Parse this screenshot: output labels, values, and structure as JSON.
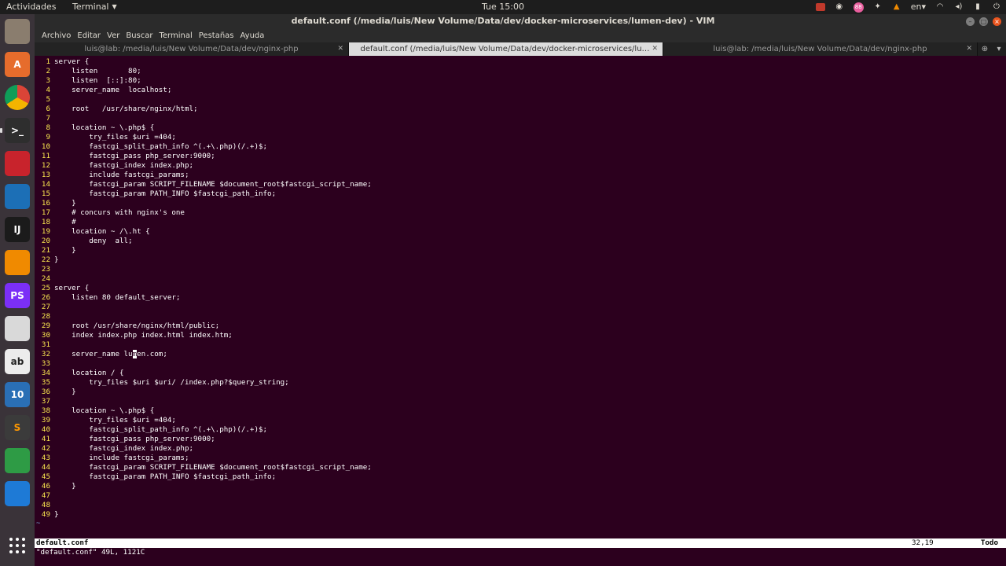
{
  "panel": {
    "activities": "Actividades",
    "app_menu": "Terminal",
    "clock": "Tue 15:00",
    "badge": "88",
    "lang": "en"
  },
  "window": {
    "title": "default.conf (/media/luis/New Volume/Data/dev/docker-microservices/lumen-dev) - VIM"
  },
  "menubar": [
    "Archivo",
    "Editar",
    "Ver",
    "Buscar",
    "Terminal",
    "Pestañas",
    "Ayuda"
  ],
  "tabs": [
    {
      "label": "luis@lab: /media/luis/New Volume/Data/dev/nginx-php",
      "active": false
    },
    {
      "label": "default.conf (/media/luis/New Volume/Data/dev/docker-microservices/lumen-de...",
      "active": true
    },
    {
      "label": "luis@lab: /media/luis/New Volume/Data/dev/nginx-php",
      "active": false
    }
  ],
  "dock": [
    {
      "name": "files-icon",
      "label": "",
      "color": "#8a7d6e"
    },
    {
      "name": "software-center-icon",
      "label": "A",
      "color": "#e66c2c"
    },
    {
      "name": "chrome-icon",
      "label": "",
      "color": "#2b7bd9"
    },
    {
      "name": "terminal-icon",
      "label": ">_",
      "color": "#2e2e2e"
    },
    {
      "name": "pdf-viewer-icon",
      "label": "",
      "color": "#c8232c"
    },
    {
      "name": "virtualbox-icon",
      "label": "",
      "color": "#1c6fb6"
    },
    {
      "name": "intellij-icon",
      "label": "IJ",
      "color": "#1b1b1b"
    },
    {
      "name": "vlc-icon",
      "label": "",
      "color": "#f08a00"
    },
    {
      "name": "phpstorm-icon",
      "label": "PS",
      "color": "#7b2ff7"
    },
    {
      "name": "text-editor-icon",
      "label": "",
      "color": "#d9d9d9"
    },
    {
      "name": "dictionary-icon",
      "label": "ab",
      "color": "#ececec"
    },
    {
      "name": "windows10-vm-icon",
      "label": "10",
      "color": "#2a6fb5"
    },
    {
      "name": "sublime-icon",
      "label": "S",
      "color": "#3b3b3b"
    },
    {
      "name": "spreadsheet-icon",
      "label": "",
      "color": "#2e9b45"
    },
    {
      "name": "vscode-icon",
      "label": "",
      "color": "#1e7ad6"
    }
  ],
  "code": [
    {
      "n": "1",
      "t": "server {"
    },
    {
      "n": "2",
      "t": "    listen       80;"
    },
    {
      "n": "3",
      "t": "    listen  [::]:80;"
    },
    {
      "n": "4",
      "t": "    server_name  localhost;"
    },
    {
      "n": "5",
      "t": ""
    },
    {
      "n": "6",
      "t": "    root   /usr/share/nginx/html;"
    },
    {
      "n": "7",
      "t": ""
    },
    {
      "n": "8",
      "t": "    location ~ \\.php$ {"
    },
    {
      "n": "9",
      "t": "        try_files $uri =404;"
    },
    {
      "n": "10",
      "t": "        fastcgi_split_path_info ^(.+\\.php)(/.+)$;"
    },
    {
      "n": "11",
      "t": "        fastcgi_pass php_server:9000;"
    },
    {
      "n": "12",
      "t": "        fastcgi_index index.php;"
    },
    {
      "n": "13",
      "t": "        include fastcgi_params;"
    },
    {
      "n": "14",
      "t": "        fastcgi_param SCRIPT_FILENAME $document_root$fastcgi_script_name;"
    },
    {
      "n": "15",
      "t": "        fastcgi_param PATH_INFO $fastcgi_path_info;"
    },
    {
      "n": "16",
      "t": "    }"
    },
    {
      "n": "17",
      "t": "    # concurs with nginx's one"
    },
    {
      "n": "18",
      "t": "    #"
    },
    {
      "n": "19",
      "t": "    location ~ /\\.ht {"
    },
    {
      "n": "20",
      "t": "        deny  all;"
    },
    {
      "n": "21",
      "t": "    }"
    },
    {
      "n": "22",
      "t": "}"
    },
    {
      "n": "23",
      "t": ""
    },
    {
      "n": "24",
      "t": ""
    },
    {
      "n": "25",
      "t": "server {"
    },
    {
      "n": "26",
      "t": "    listen 80 default_server;"
    },
    {
      "n": "27",
      "t": ""
    },
    {
      "n": "28",
      "t": ""
    },
    {
      "n": "29",
      "t": "    root /usr/share/nginx/html/public;"
    },
    {
      "n": "30",
      "t": "    index index.php index.html index.htm;"
    },
    {
      "n": "31",
      "t": ""
    },
    {
      "n": "32",
      "t": "    server_name lumen.com;"
    },
    {
      "n": "33",
      "t": ""
    },
    {
      "n": "34",
      "t": "    location / {"
    },
    {
      "n": "35",
      "t": "        try_files $uri $uri/ /index.php?$query_string;"
    },
    {
      "n": "36",
      "t": "    }"
    },
    {
      "n": "37",
      "t": ""
    },
    {
      "n": "38",
      "t": "    location ~ \\.php$ {"
    },
    {
      "n": "39",
      "t": "        try_files $uri =404;"
    },
    {
      "n": "40",
      "t": "        fastcgi_split_path_info ^(.+\\.php)(/.+)$;"
    },
    {
      "n": "41",
      "t": "        fastcgi_pass php_server:9000;"
    },
    {
      "n": "42",
      "t": "        fastcgi_index index.php;"
    },
    {
      "n": "43",
      "t": "        include fastcgi_params;"
    },
    {
      "n": "44",
      "t": "        fastcgi_param SCRIPT_FILENAME $document_root$fastcgi_script_name;"
    },
    {
      "n": "45",
      "t": "        fastcgi_param PATH_INFO $fastcgi_path_info;"
    },
    {
      "n": "46",
      "t": "    }"
    },
    {
      "n": "47",
      "t": ""
    },
    {
      "n": "48",
      "t": ""
    },
    {
      "n": "49",
      "t": "}"
    }
  ],
  "cursor": {
    "line": "32",
    "col": "19"
  },
  "tilde": "~",
  "status": {
    "file": "default.conf",
    "position": "32,19",
    "scroll": "Todo"
  },
  "cmdline": "\"default.conf\" 49L, 1121C",
  "colors": {
    "background": "#2c001e",
    "line_numbers": "#fce94f",
    "text": "#ffffff"
  }
}
